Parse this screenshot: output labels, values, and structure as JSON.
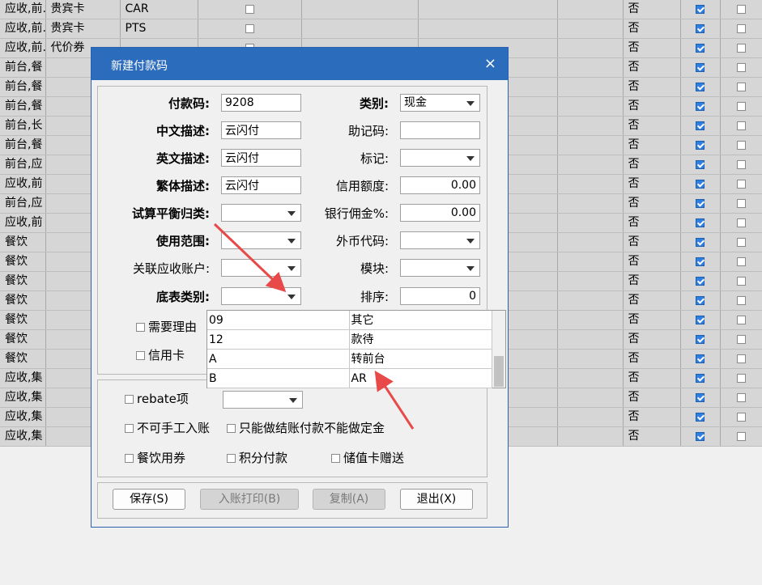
{
  "background": {
    "rows": [
      {
        "c1": "应收,前...",
        "c2": "贵宾卡",
        "c3": "CAR",
        "cb": false,
        "flag": "否",
        "on": true
      },
      {
        "c1": "应收,前...",
        "c2": "贵宾卡",
        "c3": "PTS",
        "cb": false,
        "flag": "否",
        "on": true
      },
      {
        "c1": "应收,前...",
        "c2": "代价券",
        "c3": "",
        "cb": false,
        "flag": "否",
        "on": true
      },
      {
        "c1": "前台,餐",
        "c2": "",
        "c3": "",
        "cb": false,
        "flag": "否",
        "on": true
      },
      {
        "c1": "前台,餐",
        "c2": "",
        "c3": "",
        "cb": false,
        "flag": "否",
        "on": true
      },
      {
        "c1": "前台,餐",
        "c2": "",
        "c3": "",
        "cb": false,
        "flag": "否",
        "on": true
      },
      {
        "c1": "前台,长",
        "c2": "",
        "c3": "",
        "cb": false,
        "flag": "否",
        "on": true
      },
      {
        "c1": "前台,餐",
        "c2": "",
        "c3": "",
        "cb": false,
        "flag": "否",
        "on": true
      },
      {
        "c1": "前台,应",
        "c2": "",
        "c3": "",
        "cb": false,
        "flag": "否",
        "on": true
      },
      {
        "c1": "应收,前",
        "c2": "",
        "c3": "",
        "cb": false,
        "flag": "否",
        "on": true
      },
      {
        "c1": "前台,应",
        "c2": "",
        "c3": "",
        "cb": false,
        "flag": "否",
        "on": true
      },
      {
        "c1": "应收,前",
        "c2": "",
        "c3": "",
        "cb": false,
        "flag": "否",
        "on": true
      },
      {
        "c1": "餐饮",
        "c2": "",
        "c3": "",
        "cb": false,
        "flag": "否",
        "on": true
      },
      {
        "c1": "餐饮",
        "c2": "",
        "c3": "",
        "cb": false,
        "flag": "否",
        "on": true
      },
      {
        "c1": "餐饮",
        "c2": "",
        "c3": "",
        "cb": false,
        "flag": "否",
        "on": true
      },
      {
        "c1": "餐饮",
        "c2": "",
        "c3": "",
        "cb": false,
        "flag": "否",
        "on": true
      },
      {
        "c1": "餐饮",
        "c2": "",
        "c3": "",
        "cb": false,
        "flag": "否",
        "on": true
      },
      {
        "c1": "餐饮",
        "c2": "",
        "c3": "",
        "cb": false,
        "flag": "否",
        "on": true
      },
      {
        "c1": "餐饮",
        "c2": "",
        "c3": "",
        "cb": false,
        "flag": "否",
        "on": true
      },
      {
        "c1": "应收,集",
        "c2": "",
        "c3": "",
        "cb": false,
        "flag": "否",
        "on": true
      },
      {
        "c1": "应收,集",
        "c2": "",
        "c3": "",
        "cb": false,
        "flag": "否",
        "on": true
      },
      {
        "c1": "应收,集",
        "c2": "",
        "c3": "",
        "cb": false,
        "flag": "否",
        "on": true
      },
      {
        "c1": "应收,集",
        "c2": "",
        "c3": "",
        "cb": false,
        "flag": "否",
        "on": true
      }
    ]
  },
  "dialog": {
    "title": "新建付款码",
    "close_icon": "×",
    "labels": {
      "code": "付款码:",
      "cn_desc": "中文描述:",
      "en_desc": "英文描述:",
      "tw_desc": "繁体描述:",
      "balance_class": "试算平衡归类:",
      "scope": "使用范围:",
      "ar_account": "关联应收账户:",
      "base_type": "底表类别:",
      "category": "类别:",
      "mnemonic": "助记码:",
      "mark": "标记:",
      "credit": "信用额度:",
      "bank_fee": "银行佣金%:",
      "currency": "外币代码:",
      "module": "模块:",
      "sort": "排序:"
    },
    "values": {
      "code": "9208",
      "cn_desc": "云闪付",
      "en_desc": "云闪付",
      "tw_desc": "云闪付",
      "category": "现金",
      "credit": "0.00",
      "bank_fee": "0.00",
      "sort": "0"
    },
    "checks": {
      "need_reason": "需要理由",
      "credit_card": "信用卡",
      "rebate": "rebate项",
      "no_manual": "不可手工入账",
      "settle_only": "只能做结账付款不能做定金",
      "fb_coupon": "餐饮用券",
      "points": "积分付款",
      "stored_value": "储值卡赠送"
    },
    "buttons": {
      "save": "保存(S)",
      "post_print": "入账打印(B)",
      "copy": "复制(A)",
      "exit": "退出(X)"
    }
  },
  "dropdown": {
    "options": [
      {
        "code": "09",
        "name": "其它"
      },
      {
        "code": "12",
        "name": "款待"
      },
      {
        "code": "A",
        "name": "转前台"
      },
      {
        "code": "B",
        "name": "AR"
      }
    ]
  },
  "colors": {
    "titlebar": "#2c6cbd",
    "checked": "#2f7fe0",
    "annotation_arrow": "#e84a4a"
  }
}
